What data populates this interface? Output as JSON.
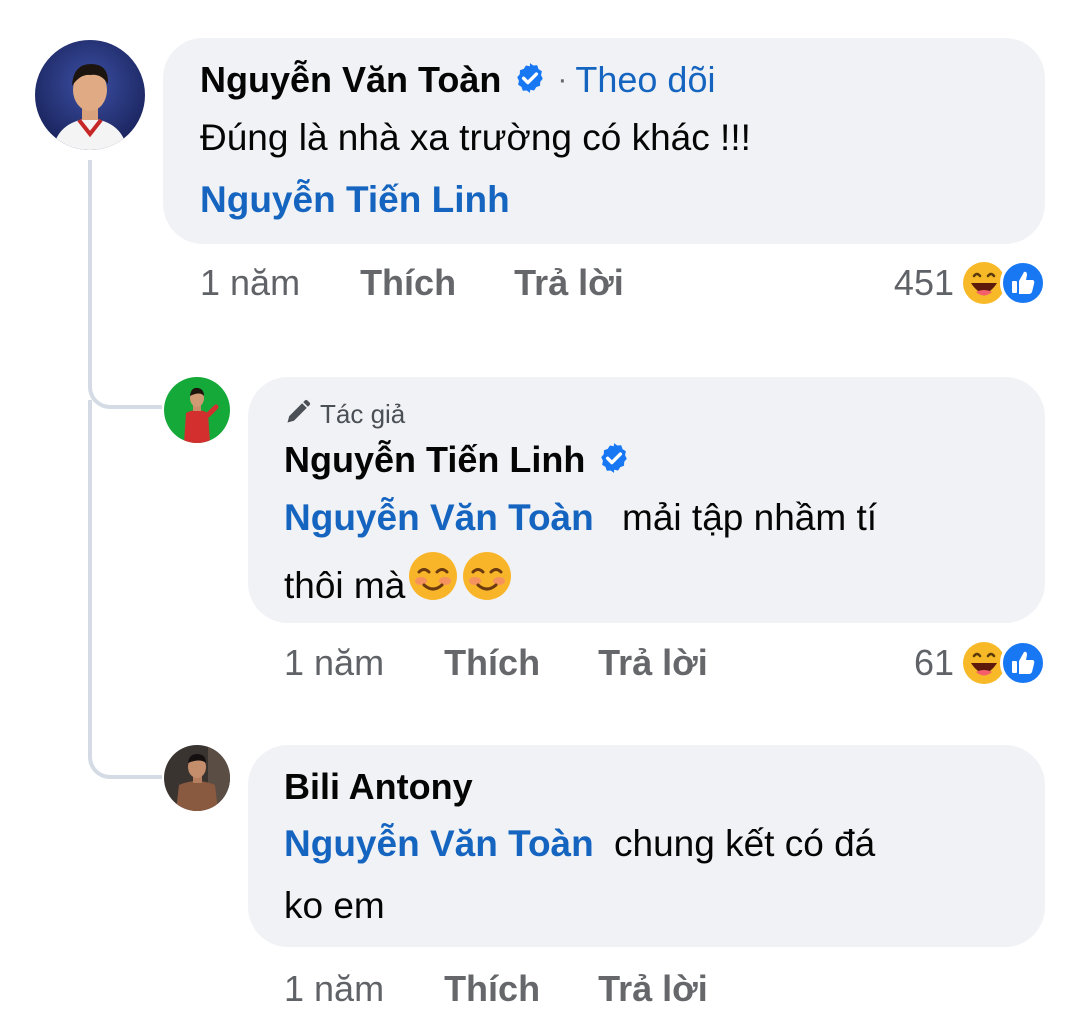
{
  "comments": [
    {
      "author": "Nguyễn Văn Toàn",
      "follow_label": "Theo dõi",
      "follow_separator": "·",
      "text": "Đúng là nhà xa trường có khác !!!",
      "mention": "Nguyễn Tiến Linh",
      "time": "1 năm",
      "like_label": "Thích",
      "reply_label": "Trả lời",
      "reaction_count": "451"
    },
    {
      "badge": "Tác giả",
      "author": "Nguyễn Tiến Linh",
      "mention": "Nguyễn Văn Toàn",
      "text_line1": "mải tập nhầm tí",
      "text_line2": "thôi mà",
      "time": "1 năm",
      "like_label": "Thích",
      "reply_label": "Trả lời",
      "reaction_count": "61"
    },
    {
      "author": "Bili Antony",
      "mention": "Nguyễn Văn Toàn",
      "text_line1": "chung kết có đá",
      "text_line2": "ko em",
      "time": "1 năm",
      "like_label": "Thích",
      "reply_label": "Trả lời"
    }
  ],
  "colors": {
    "bubble": "#f0f2f5",
    "link": "#1565c0",
    "verified": "#1877f2",
    "meta": "#65676b"
  },
  "icons": {
    "verified": "verified-badge-icon",
    "author_badge": "pencil-icon",
    "reaction_haha": "haha-emoji-icon",
    "reaction_like": "like-thumb-icon",
    "smile": "smiling-face-emoji-icon"
  }
}
